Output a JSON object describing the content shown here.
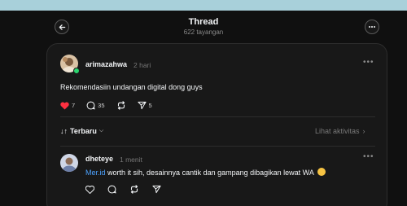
{
  "header": {
    "title": "Thread",
    "views": "622 tayangan"
  },
  "post": {
    "username": "arimazahwa",
    "time": "2 hari",
    "text": "Rekomendasiin undangan digital dong guys",
    "likes": "7",
    "comments": "35",
    "shares": "5",
    "liked_color": "#ff3040"
  },
  "sort": {
    "label": "Terbaru",
    "activity_link": "Lihat aktivitas"
  },
  "reply": {
    "username": "dheteye",
    "time": "1 menit",
    "mention": "Mer.id",
    "text": " worth it sih, desainnya cantik dan gampang dibagikan lewat WA "
  },
  "icons": {
    "back": "arrow-left-icon",
    "more": "more-horizontal-icon",
    "like": "heart-icon",
    "comment": "comment-icon",
    "repost": "repost-icon",
    "share": "send-icon",
    "emoji": "smiling-face-emoji"
  }
}
